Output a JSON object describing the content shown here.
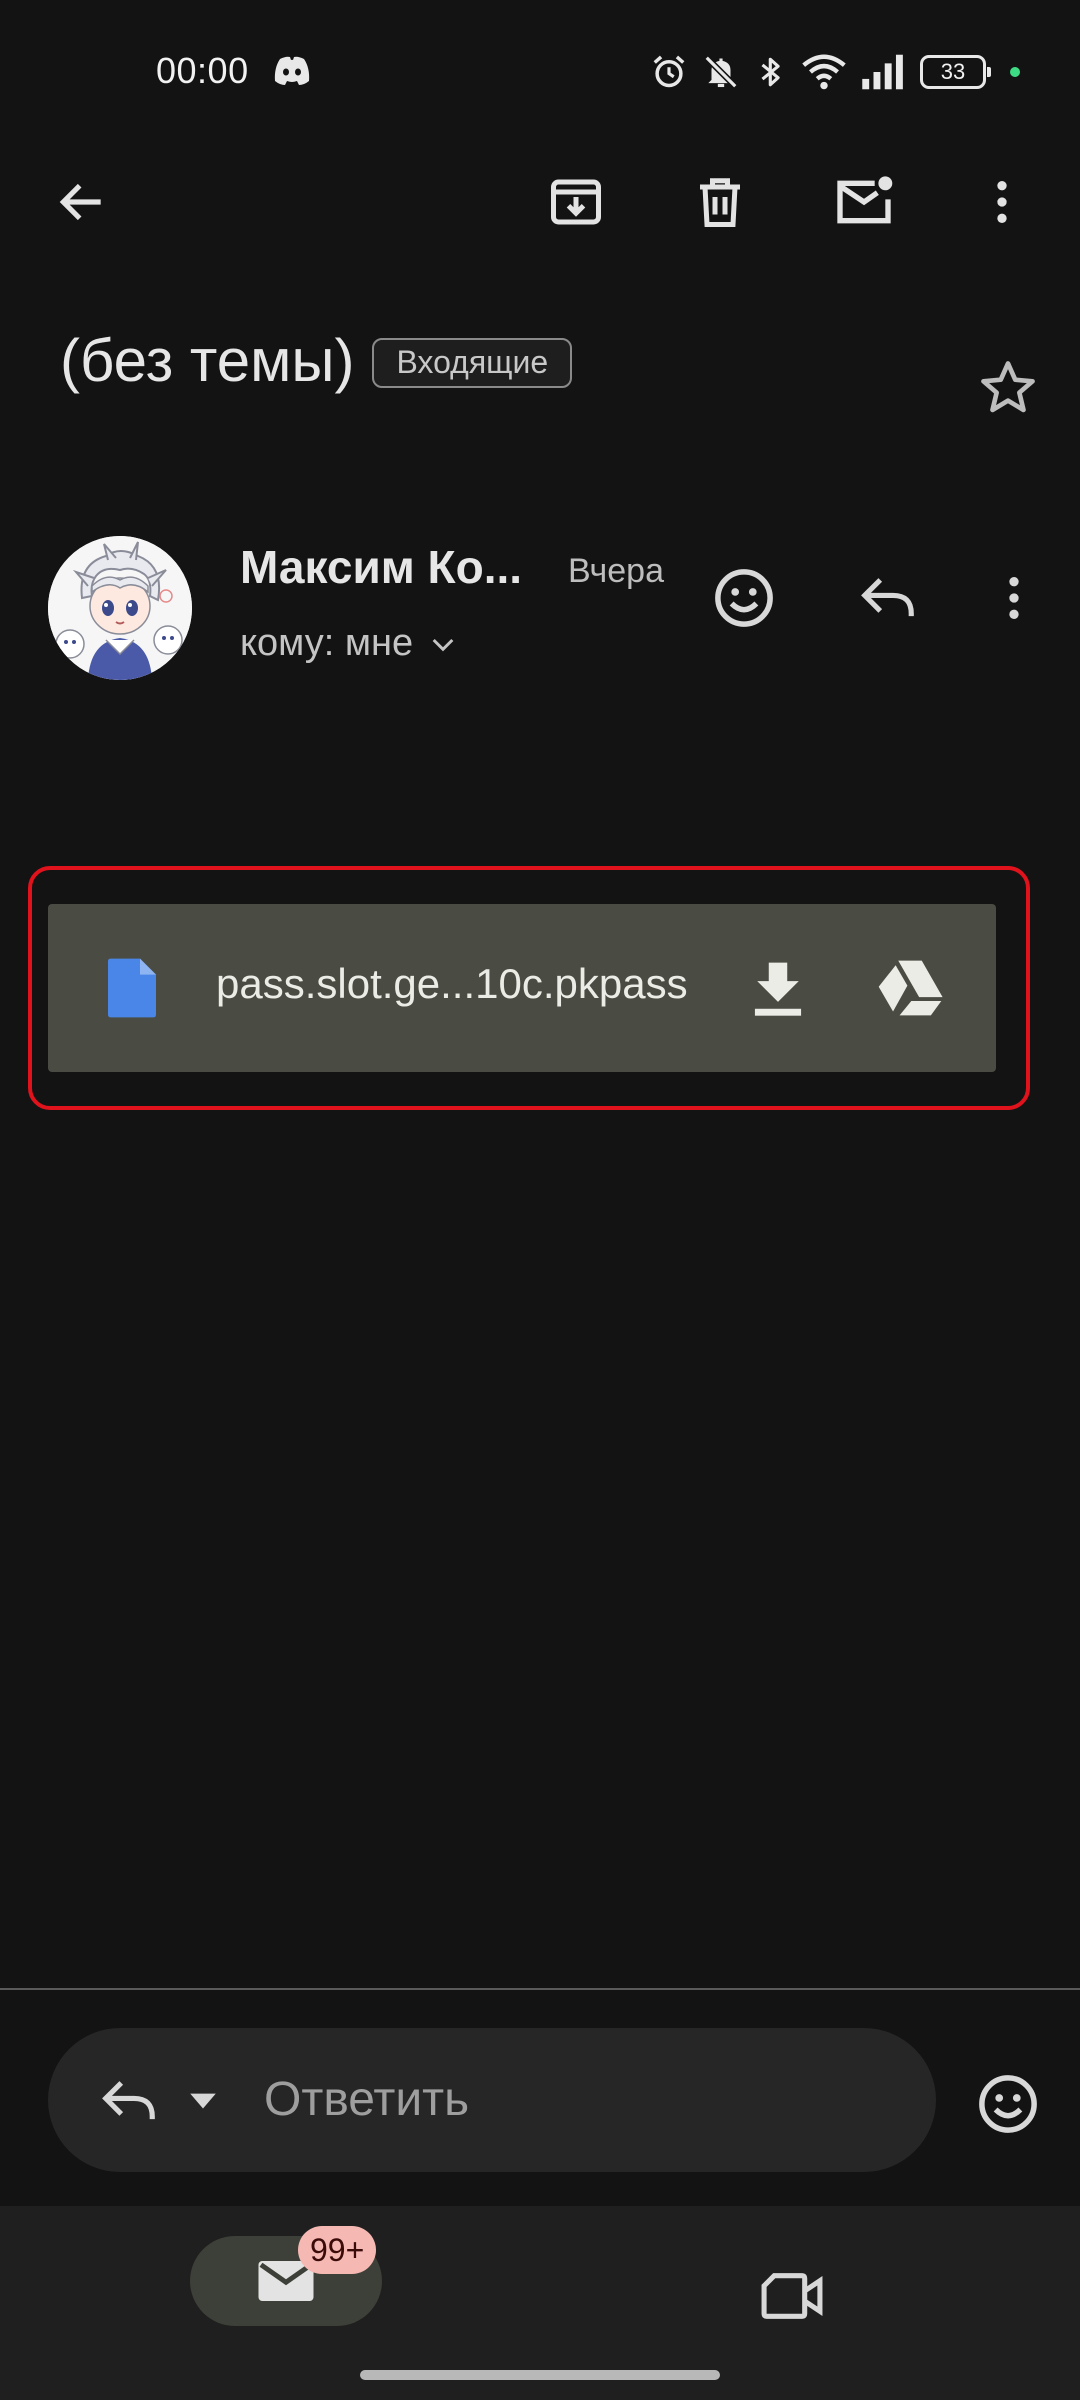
{
  "status_bar": {
    "time": "00:00",
    "app_icon": "discord-icon",
    "battery_level": "33",
    "icons": [
      "alarm-icon",
      "bell-muted-icon",
      "bluetooth-icon",
      "wifi-icon",
      "cell-signal-icon",
      "battery-icon"
    ]
  },
  "toolbar": {
    "icons": [
      "back-arrow-icon",
      "archive-icon",
      "delete-icon",
      "mark-unread-icon",
      "more-vert-icon"
    ]
  },
  "email": {
    "subject": "(без темы)",
    "label": "Входящие",
    "sender_name": "Максим Ко...",
    "date": "Вчера",
    "recipient": "кому: мне"
  },
  "attachment": {
    "file_name": "pass.slot.ge...10c.pkpass",
    "file_icon_color": "#4a86e8",
    "highlight_color": "#e0121c"
  },
  "reply": {
    "placeholder": "Ответить"
  },
  "bottom_nav": {
    "mail_badge": "99+",
    "items": [
      "mail-icon",
      "meet-video-icon"
    ]
  },
  "colors": {
    "background": "#131313",
    "attachment_bg": "#4a4c43",
    "nav_bg": "#1f1f1f",
    "badge_bg": "#f5b8b3"
  }
}
